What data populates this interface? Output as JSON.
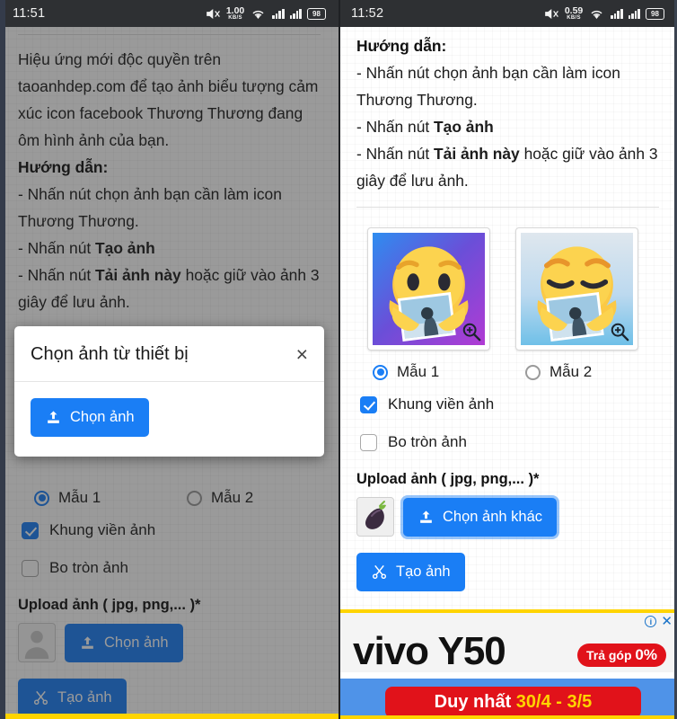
{
  "left": {
    "status": {
      "time": "11:51",
      "net_speed": "1.00",
      "net_unit": "KB/S",
      "battery": "98"
    },
    "intro": "Hiệu ứng mới độc quyền trên taoanhdep.com để tạo ảnh biểu tượng cảm xúc icon facebook Thương Thương đang ôm hình ảnh của bạn.",
    "guide_title": "Hướng dẫn:",
    "guide_1": "- Nhấn nút chọn ảnh bạn cần làm icon Thương Thương.",
    "guide_2_prefix": "- Nhấn nút ",
    "guide_2_bold": "Tạo ảnh",
    "guide_3_prefix": "- Nhấn nút ",
    "guide_3_bold": "Tải ảnh này",
    "guide_3_suffix": " hoặc giữ vào ảnh 3 giây để lưu ảnh.",
    "modal": {
      "title": "Chọn ảnh từ thiết bị",
      "close": "×",
      "choose_label": "Chọn ảnh"
    },
    "radio_1": "Mẫu 1",
    "radio_2": "Mẫu 2",
    "check_frame": "Khung viền ảnh",
    "check_round": "Bo tròn ảnh",
    "upload_label": "Upload ảnh ( jpg, png,... )*",
    "choose_button": "Chọn ảnh",
    "make_button": "Tạo ảnh"
  },
  "right": {
    "status": {
      "time": "11:52",
      "net_speed": "0.59",
      "net_unit": "KB/S",
      "battery": "98"
    },
    "guide_title": "Hướng dẫn:",
    "guide_1": "- Nhấn nút chọn ảnh bạn cần làm icon Thương Thương.",
    "guide_2_prefix": "- Nhấn nút ",
    "guide_2_bold": "Tạo ảnh",
    "guide_3_prefix": "- Nhấn nút ",
    "guide_3_bold": "Tải ảnh này",
    "guide_3_suffix": " hoặc giữ vào ảnh 3 giây để lưu ảnh.",
    "radio_1": "Mẫu 1",
    "radio_2": "Mẫu 2",
    "check_frame": "Khung viền ảnh",
    "check_round": "Bo tròn ảnh",
    "upload_label": "Upload ảnh ( jpg, png,... )*",
    "choose_other_button": "Chọn ảnh khác",
    "make_button": "Tạo ảnh",
    "ad": {
      "brand": "vivo Y50",
      "badge_text": "Trả góp ",
      "badge_pct": "0%",
      "bar_prefix": "Duy nhất ",
      "bar_dates": "30/4 - 3/5",
      "adchoice": "i",
      "close": "✕"
    }
  },
  "colors": {
    "accent_blue": "#1a7ef5",
    "ad_yellow": "#ffd400",
    "ad_red": "#e1121a",
    "statusbar": "#2e3033"
  }
}
